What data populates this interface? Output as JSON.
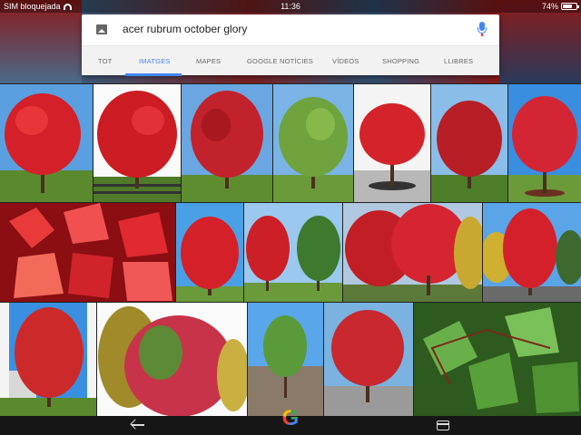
{
  "status_bar": {
    "carrier": "SIM bloquejada",
    "time": "11:36",
    "battery": "74%",
    "battery_level": 0.74
  },
  "search": {
    "query": "acer rubrum october glory",
    "tabs": [
      {
        "label": "TOT",
        "active": false
      },
      {
        "label": "IMATGES",
        "active": true
      },
      {
        "label": "MAPES",
        "active": false
      },
      {
        "label": "GOOGLE NOTÍCIES",
        "active": false
      },
      {
        "label": "VÍDEOS",
        "active": false
      },
      {
        "label": "SHOPPING",
        "active": false
      },
      {
        "label": "LLIBRES",
        "active": false
      }
    ]
  },
  "navbar": {
    "logo_letter": "G"
  },
  "colors": {
    "accent": "#4285f4",
    "foliage_red": "#d8222a",
    "foliage_green": "#5a9a3a",
    "sky": "#4f9be0",
    "grass": "#5b8a2e"
  },
  "image_results": [
    {
      "name": "red-maple-lawn",
      "foliage": "red",
      "bg": "sky"
    },
    {
      "name": "red-maple-fence",
      "foliage": "red",
      "bg": "white"
    },
    {
      "name": "red-maple-park",
      "foliage": "red",
      "bg": "sky"
    },
    {
      "name": "green-maple",
      "foliage": "green",
      "bg": "sky"
    },
    {
      "name": "red-maple-parking",
      "foliage": "red",
      "bg": "white"
    },
    {
      "name": "red-maple-field",
      "foliage": "red",
      "bg": "sky"
    },
    {
      "name": "red-maple-small",
      "foliage": "red",
      "bg": "sky"
    },
    {
      "name": "red-leaves-closeup",
      "foliage": "leaves",
      "bg": "red"
    },
    {
      "name": "red-maple-round",
      "foliage": "red",
      "bg": "sky"
    },
    {
      "name": "red-and-green-trees",
      "foliage": "mixed",
      "bg": "sky"
    },
    {
      "name": "red-maple-row",
      "foliage": "red",
      "bg": "sky"
    },
    {
      "name": "red-maple-lot",
      "foliage": "red",
      "bg": "sky"
    },
    {
      "name": "red-maple-house",
      "foliage": "red",
      "bg": "white"
    },
    {
      "name": "autumn-mixed-trees",
      "foliage": "mixed",
      "bg": "white"
    },
    {
      "name": "green-young-maple",
      "foliage": "green",
      "bg": "sky"
    },
    {
      "name": "red-maple-street",
      "foliage": "red",
      "bg": "sky"
    },
    {
      "name": "green-leaves-closeup",
      "foliage": "leaves-green",
      "bg": "green"
    }
  ]
}
